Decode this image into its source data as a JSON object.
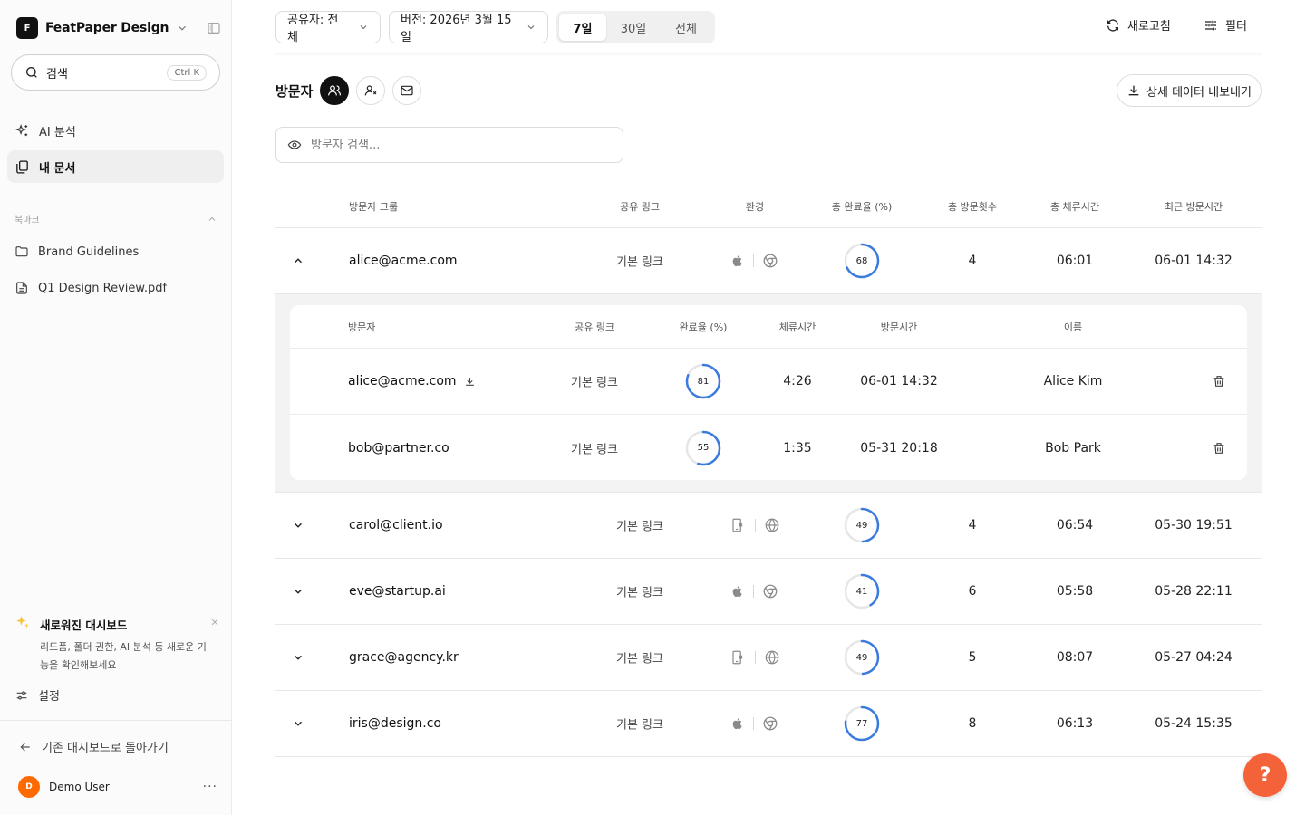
{
  "sidebar": {
    "workspace_initial": "F",
    "workspace_name": "FeatPaper Design",
    "search_label": "검색",
    "search_shortcut": "Ctrl K",
    "nav": [
      {
        "label": "AI 분석",
        "icon": "sparkles-icon"
      },
      {
        "label": "내 문서",
        "icon": "documents-icon",
        "active": true
      }
    ],
    "bookmarks_title": "북마크",
    "bookmarks": [
      {
        "label": "Brand Guidelines",
        "icon": "folder-icon"
      },
      {
        "label": "Q1 Design Review.pdf",
        "icon": "file-icon"
      }
    ],
    "promo_title": "새로워진 대시보드",
    "promo_desc": "리드폼, 폴더 권한, AI 분석 등 새로운 기능을 확인해보세요",
    "settings_label": "설정",
    "back_label": "기존 대시보드로 돌아가기",
    "user_initial": "D",
    "user_name": "Demo User",
    "user_more": "···"
  },
  "toolbar": {
    "sharer_filter": "공유자: 전체",
    "version_filter": "버전: 2026년 3월 15일",
    "periods": [
      "7일",
      "30일",
      "전체"
    ],
    "active_period": "7일",
    "refresh_label": "새로고침",
    "filter_label": "필터"
  },
  "visitors": {
    "title": "방문자",
    "export_label": "상세 데이터 내보내기",
    "search_placeholder": "방문자 검색...",
    "columns": {
      "group": "방문자 그룹",
      "link": "공유 링크",
      "env": "환경",
      "completion": "총 완료율 (%)",
      "visits": "총 방문횟수",
      "duration": "총 체류시간",
      "last_visit": "최근 방문시간"
    },
    "rows": [
      {
        "email": "alice@acme.com",
        "link": "기본 링크",
        "os": "apple",
        "browser": "chrome",
        "completion": 68,
        "visits": "4",
        "duration": "06:01",
        "last_visit": "06-01 14:32",
        "expanded": true
      },
      {
        "email": "carol@client.io",
        "link": "기본 링크",
        "os": "mobile",
        "browser": "globe",
        "completion": 49,
        "visits": "4",
        "duration": "06:54",
        "last_visit": "05-30 19:51"
      },
      {
        "email": "eve@startup.ai",
        "link": "기본 링크",
        "os": "apple",
        "browser": "chrome",
        "completion": 41,
        "visits": "6",
        "duration": "05:58",
        "last_visit": "05-28 22:11"
      },
      {
        "email": "grace@agency.kr",
        "link": "기본 링크",
        "os": "mobile",
        "browser": "globe",
        "completion": 49,
        "visits": "5",
        "duration": "08:07",
        "last_visit": "05-27 04:24"
      },
      {
        "email": "iris@design.co",
        "link": "기본 링크",
        "os": "apple",
        "browser": "chrome",
        "completion": 77,
        "visits": "8",
        "duration": "06:13",
        "last_visit": "05-24 15:35"
      }
    ],
    "detail": {
      "columns": {
        "visitor": "방문자",
        "link": "공유 링크",
        "completion": "완료율 (%)",
        "duration": "체류시간",
        "visit_time": "방문시간",
        "name": "이름"
      },
      "rows": [
        {
          "email": "alice@acme.com",
          "downloaded": true,
          "link": "기본 링크",
          "completion": 81,
          "duration": "4:26",
          "visit_time": "06-01 14:32",
          "name": "Alice Kim"
        },
        {
          "email": "bob@partner.co",
          "downloaded": false,
          "link": "기본 링크",
          "completion": 55,
          "duration": "1:35",
          "visit_time": "05-31 20:18",
          "name": "Bob Park"
        }
      ]
    }
  },
  "help_label": "?",
  "colors": {
    "accent": "#3b7be0",
    "ring_track": "#e6e6e6",
    "help": "#f4623a",
    "avatar": "#ff6a00"
  }
}
